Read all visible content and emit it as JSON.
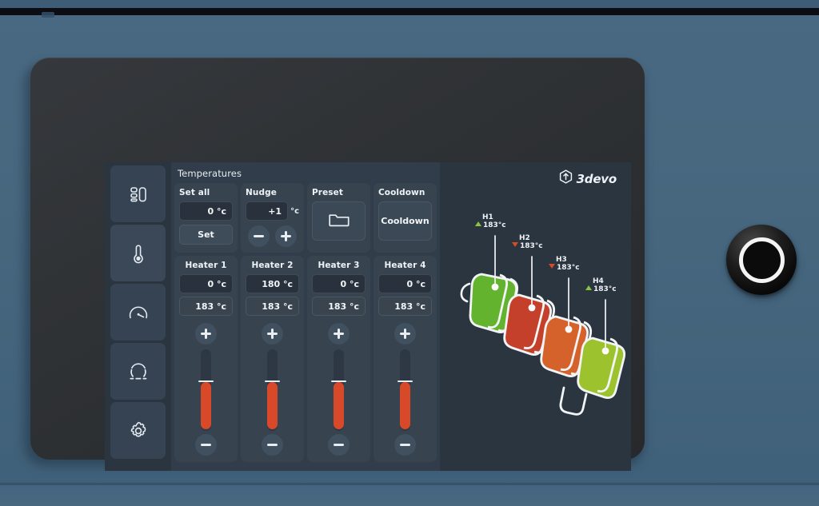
{
  "device": {
    "brand": "3devo",
    "knob_label": "control-knob"
  },
  "sidebar": {
    "items": [
      {
        "name": "dashboard",
        "icon": "layout-dashboard-icon",
        "active": false
      },
      {
        "name": "temperatures",
        "icon": "thermometer-icon",
        "active": true
      },
      {
        "name": "speed",
        "icon": "gauge-icon",
        "active": false
      },
      {
        "name": "spooling",
        "icon": "dashed-spool-icon",
        "active": false
      },
      {
        "name": "settings",
        "icon": "gear-icon",
        "active": false
      }
    ]
  },
  "panel": {
    "title": "Temperatures"
  },
  "cards": {
    "set_all": {
      "title": "Set all",
      "value": "0 °c",
      "button": "Set"
    },
    "nudge": {
      "title": "Nudge",
      "value": "+1",
      "unit": "°c",
      "minus": "−",
      "plus": "+"
    },
    "preset": {
      "title": "Preset",
      "icon": "folder-icon"
    },
    "cooldown": {
      "title": "Cooldown",
      "button": "Cooldown"
    }
  },
  "heaters": [
    {
      "title": "Heater 1",
      "setpoint": "0 °c",
      "current": "183 °c",
      "slider_percent": 58
    },
    {
      "title": "Heater 2",
      "setpoint": "180 °c",
      "current": "183 °c",
      "slider_percent": 58
    },
    {
      "title": "Heater 3",
      "setpoint": "0 °c",
      "current": "183 °c",
      "slider_percent": 58
    },
    {
      "title": "Heater 4",
      "setpoint": "0 °c",
      "current": "183 °c",
      "slider_percent": 58
    }
  ],
  "barrel": {
    "zones": [
      {
        "label": "H1",
        "value": "183°c",
        "trend": "up",
        "color": "#63b32e"
      },
      {
        "label": "H2",
        "value": "183°c",
        "trend": "down",
        "color": "#c4402a"
      },
      {
        "label": "H3",
        "value": "183°c",
        "trend": "down",
        "color": "#d4622a"
      },
      {
        "label": "H4",
        "value": "183°c",
        "trend": "up",
        "color": "#9cc32e"
      }
    ]
  },
  "colors": {
    "screen_bg": "#2b3540",
    "pane_bg": "#313d4a",
    "card_bg": "#37434f",
    "accent_hot": "#d8492a",
    "accent_ok": "#8bc540"
  }
}
